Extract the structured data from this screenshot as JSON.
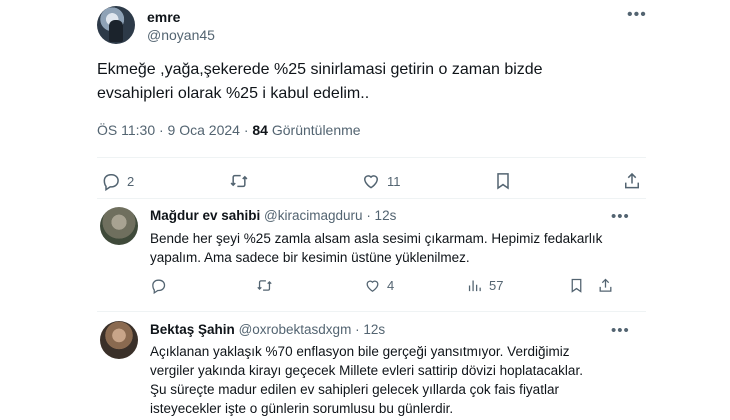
{
  "tweet": {
    "name": "emre",
    "handle": "@noyan45",
    "more": "•••",
    "text_line1": "Ekmeğe ,yağa,şekerede %25 sinirlamasi getirin o zaman bizde",
    "text_line2": "evsahipleri olarak %25 i kabul edelim..",
    "time": "ÖS 11:30 · 9 Oca 2024 ·",
    "views_count": "84",
    "views_label": "Görüntülenme",
    "actions": {
      "replies": "2",
      "retweets": "",
      "likes": "11"
    }
  },
  "replies": [
    {
      "name": "Mağdur ev sahibi",
      "handle": "@kiracimagduru",
      "time": "· 12s",
      "more": "•••",
      "text_line1": "Bende her şeyi %25 zamla alsam asla sesimi çıkarmam. Hepimiz fedakarlık",
      "text_line2": "yapalım. Ama sadece bir kesimin üstüne yüklenilmez.",
      "actions": {
        "replies": "",
        "retweets": "",
        "likes": "4",
        "views": "57"
      }
    },
    {
      "name": "Bektaş Şahin",
      "handle": "@oxrobektasdxgm",
      "time": "· 12s",
      "more": "•••",
      "text_line1": "Açıklanan yaklaşık %70 enflasyon bile gerçeği yansıtmıyor. Verdiğimiz",
      "text_line2": "vergiler yakında kirayı geçecek Millete evleri sattirip dövizi hoplatacaklar.",
      "text_line3": "Şu süreçte madur edilen ev sahipleri gelecek yıllarda çok fais fiyatlar",
      "text_line4": "isteyecekler işte o günlerin sorumlusu bu günlerdir."
    }
  ]
}
